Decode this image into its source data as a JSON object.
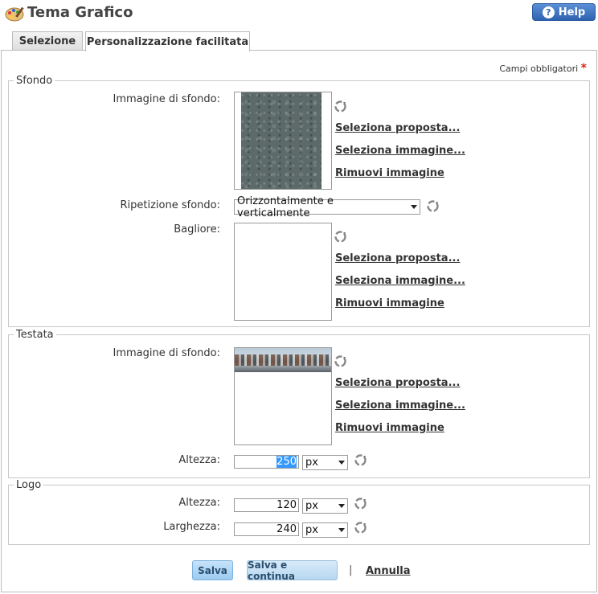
{
  "header": {
    "title": "Tema Grafico",
    "help_label": "Help",
    "help_icon": "question-icon",
    "app_icon": "palette-icon"
  },
  "tabs": [
    {
      "label": "Selezione",
      "active": false
    },
    {
      "label": "Personalizzazione facilitata",
      "active": true
    }
  ],
  "required_note": "Campi obbligatori",
  "required_mark": "*",
  "sections": {
    "sfondo": {
      "legend": "Sfondo",
      "background_image_label": "Immagine di sfondo:",
      "repeat_label": "Ripetizione sfondo:",
      "repeat_value": "Orizzontalmente e verticalmente",
      "glare_label": "Bagliore:"
    },
    "testata": {
      "legend": "Testata",
      "background_image_label": "Immagine di sfondo:",
      "height_label": "Altezza:",
      "height_value": "250",
      "height_unit": "px"
    },
    "logo": {
      "legend": "Logo",
      "height_label": "Altezza:",
      "height_value": "120",
      "height_unit": "px",
      "width_label": "Larghezza:",
      "width_value": "240",
      "width_unit": "px"
    }
  },
  "image_actions": {
    "select_proposal": "Seleziona proposta...",
    "select_image": "Seleziona immagine...",
    "remove_image": "Rimuovi immagine"
  },
  "footer": {
    "save": "Salva",
    "save_continue": "Salva e continua",
    "separator": "|",
    "cancel": "Annulla"
  },
  "colors": {
    "help_button": "#2f63b0",
    "required_star": "#d21111",
    "save_button": "#9ccbf0"
  }
}
